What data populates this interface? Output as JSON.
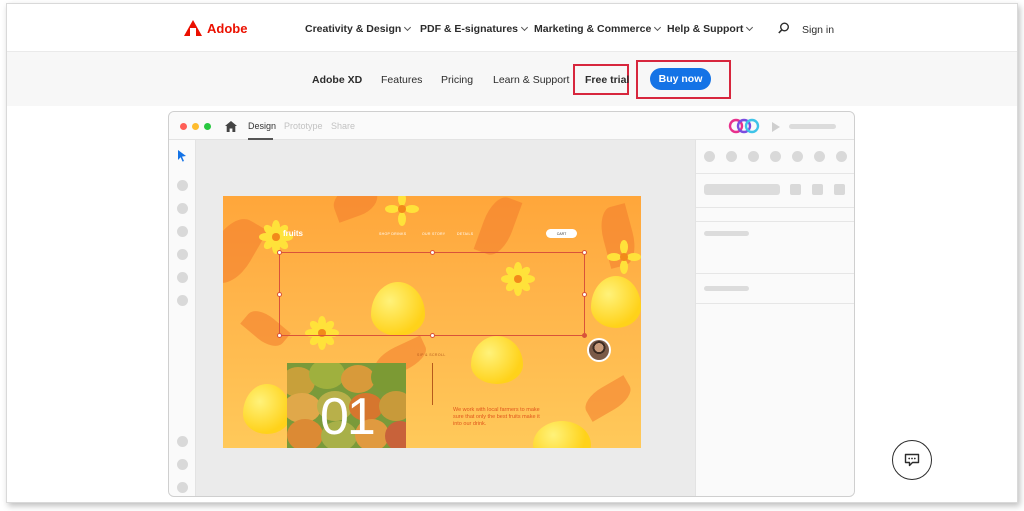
{
  "global_nav": {
    "brand": "Adobe",
    "items": [
      {
        "label": "Creativity & Design"
      },
      {
        "label": "PDF & E-signatures"
      },
      {
        "label": "Marketing & Commerce"
      },
      {
        "label": "Help & Support"
      }
    ],
    "search_icon": "search-icon",
    "signin_label": "Sign in"
  },
  "local_nav": {
    "product": "Adobe XD",
    "items": [
      {
        "label": "Features"
      },
      {
        "label": "Pricing"
      },
      {
        "label": "Learn & Support"
      }
    ],
    "free_trial_label": "Free trial",
    "buy_now_label": "Buy now",
    "highlight_color": "#d7263d",
    "accent_color": "#1473e6"
  },
  "app_mockup": {
    "tabs": [
      {
        "label": "Design",
        "active": true
      },
      {
        "label": "Prototype",
        "active": false
      },
      {
        "label": "Share",
        "active": false
      }
    ],
    "artboard": {
      "logo": "fruits",
      "nav": [
        "SHOP DRINKS",
        "OUR STORY",
        "DETAILS"
      ],
      "cart": "CART",
      "sip_label": "SIP & SCROLL",
      "number": "01",
      "copy": "We work with local farmers to make sure that only the best fruits make it into our drink."
    }
  },
  "chat": {
    "icon": "chat-icon"
  }
}
